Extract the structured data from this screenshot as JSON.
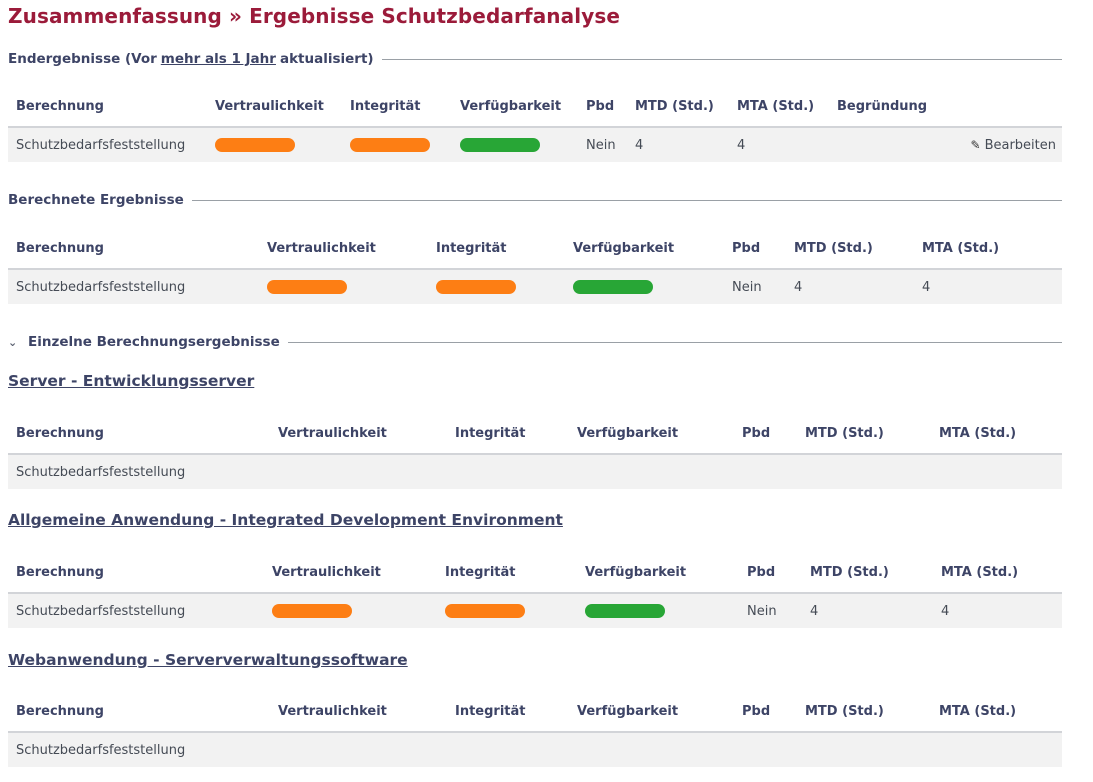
{
  "page_title": "Zusammenfassung » Ergebnisse Schutzbedarfanalyse",
  "colors": {
    "orange": "#fd7e14",
    "green": "#28a636"
  },
  "end": {
    "prefix": "Endergebnisse (Vor",
    "link": "mehr als 1 Jahr",
    "suffix": "aktualisiert)",
    "headers": [
      "Berechnung",
      "Vertraulichkeit",
      "Integrität",
      "Verfügbarkeit",
      "Pbd",
      "MTD (Std.)",
      "MTA (Std.)",
      "Begründung"
    ],
    "row": {
      "berechnung": "Schutzbedarfsfeststellung",
      "vertraulichkeit": "orange",
      "integritaet": "orange",
      "verfuegbarkeit": "green",
      "pbd": "Nein",
      "mtd": "4",
      "mta": "4",
      "edit_label": "Bearbeiten",
      "edit_icon": "pencil-icon"
    }
  },
  "calc": {
    "heading": "Berechnete Ergebnisse",
    "headers": [
      "Berechnung",
      "Vertraulichkeit",
      "Integrität",
      "Verfügbarkeit",
      "Pbd",
      "MTD (Std.)",
      "MTA (Std.)"
    ],
    "row": {
      "berechnung": "Schutzbedarfsfeststellung",
      "vertraulichkeit": "orange",
      "integritaet": "orange",
      "verfuegbarkeit": "green",
      "pbd": "Nein",
      "mtd": "4",
      "mta": "4"
    }
  },
  "single": {
    "heading": "Einzelne Berechnungsergebnisse",
    "toggle_icon": "chevron-down-icon",
    "headers": [
      "Berechnung",
      "Vertraulichkeit",
      "Integrität",
      "Verfügbarkeit",
      "Pbd",
      "MTD (Std.)",
      "MTA (Std.)"
    ],
    "items": [
      {
        "title": "Server - Entwicklungsserver",
        "row": {
          "berechnung": "Schutzbedarfsfeststellung",
          "vertraulichkeit": "",
          "integritaet": "",
          "verfuegbarkeit": "",
          "pbd": "",
          "mtd": "",
          "mta": ""
        }
      },
      {
        "title": "Allgemeine Anwendung - Integrated Development Environment",
        "row": {
          "berechnung": "Schutzbedarfsfeststellung",
          "vertraulichkeit": "orange",
          "integritaet": "orange",
          "verfuegbarkeit": "green",
          "pbd": "Nein",
          "mtd": "4",
          "mta": "4"
        }
      },
      {
        "title": "Webanwendung - Serververwaltungssoftware",
        "row": {
          "berechnung": "Schutzbedarfsfeststellung",
          "vertraulichkeit": "",
          "integritaet": "",
          "verfuegbarkeit": "",
          "pbd": "",
          "mtd": "",
          "mta": ""
        }
      }
    ]
  }
}
